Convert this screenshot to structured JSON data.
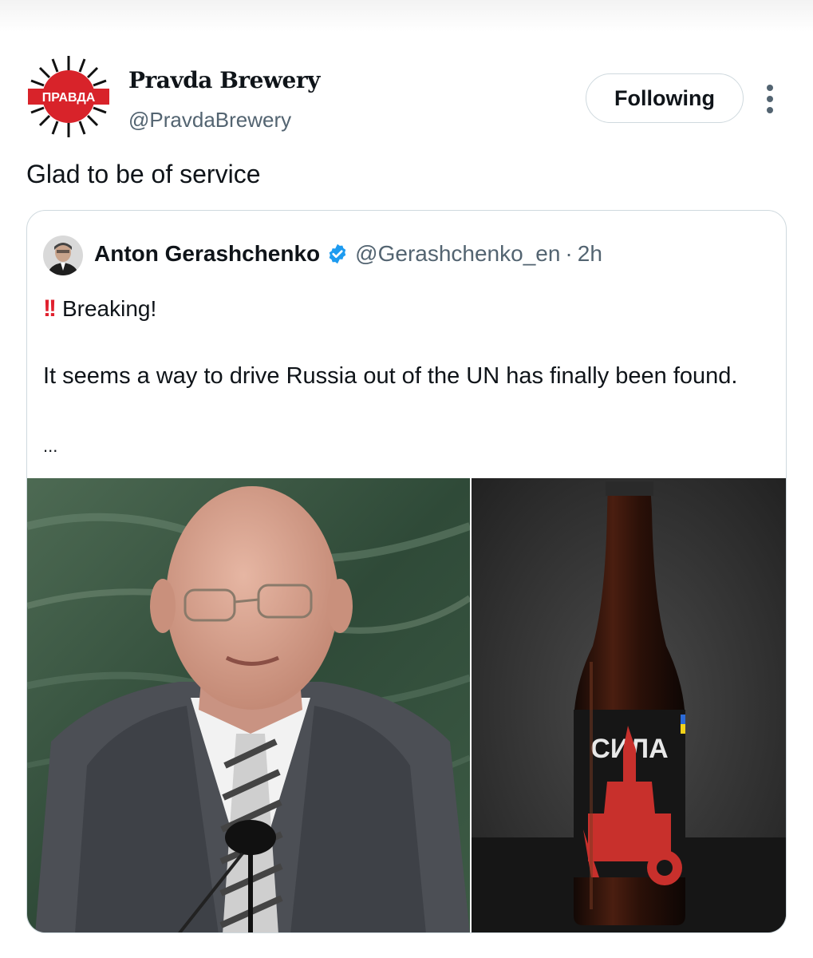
{
  "author": {
    "name": "Pravda Brewery",
    "handle": "@PravdaBrewery",
    "logo_text": "ПРАВДА"
  },
  "follow_button": {
    "label": "Following"
  },
  "more_icon": "more-vertical-icon",
  "post": {
    "text": "Glad to be of service"
  },
  "quoted_post": {
    "author_name": "Anton Gerashchenko",
    "verified": true,
    "verified_icon": "verified-badge-icon",
    "handle": "@Gerashchenko_en",
    "separator": "·",
    "time": "2h",
    "emoji_icon": "double-exclamation-icon",
    "emoji_glyph": "!!",
    "line1": "Breaking!",
    "body": "It seems a way to drive Russia out of the UN has finally been found.",
    "ellipsis": "...",
    "bottle_label": "СИЛА"
  },
  "colors": {
    "text_primary": "#0f1419",
    "text_secondary": "#536471",
    "border": "#cfd9de",
    "verified_blue": "#1d9bf0",
    "logo_red": "#d8232a"
  }
}
